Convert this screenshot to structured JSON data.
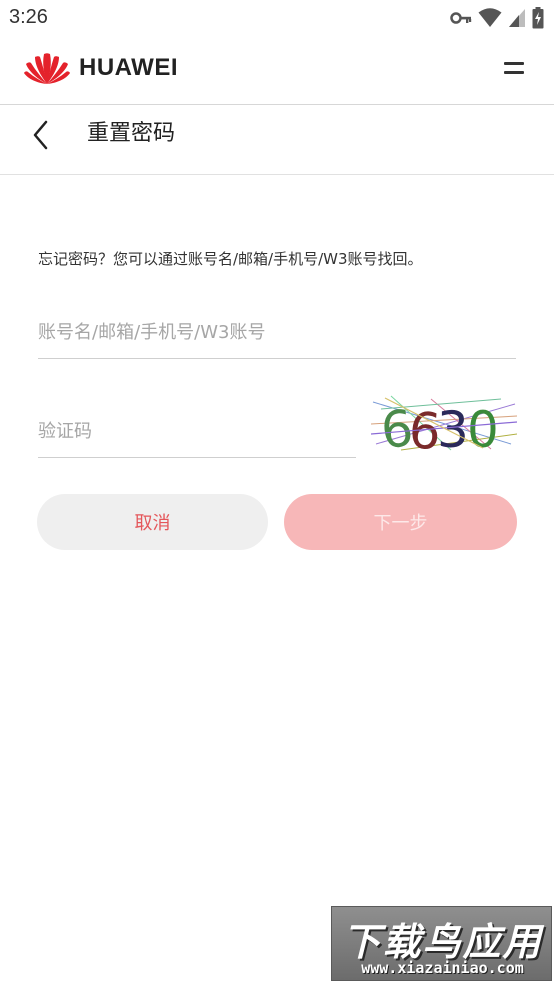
{
  "status_bar": {
    "time": "3:26",
    "icons": [
      "vpn-key-icon",
      "wifi-icon",
      "signal-icon",
      "battery-charging-icon"
    ]
  },
  "header": {
    "brand": "HUAWEI",
    "brand_color": "#e4222b",
    "menu_icon": "hamburger-menu-icon"
  },
  "subheader": {
    "back_icon": "chevron-left-icon",
    "title": "重置密码"
  },
  "form": {
    "hint": "忘记密码？您可以通过账号名/邮箱/手机号/W3账号找回。",
    "account_placeholder": "账号名/邮箱/手机号/W3账号",
    "account_value": "",
    "code_placeholder": "验证码",
    "code_value": "",
    "captcha_text": "6630"
  },
  "buttons": {
    "cancel_label": "取消",
    "next_label": "下一步"
  },
  "watermark": {
    "title": "下载鸟应用",
    "url": "www.xiazainiao.com"
  }
}
